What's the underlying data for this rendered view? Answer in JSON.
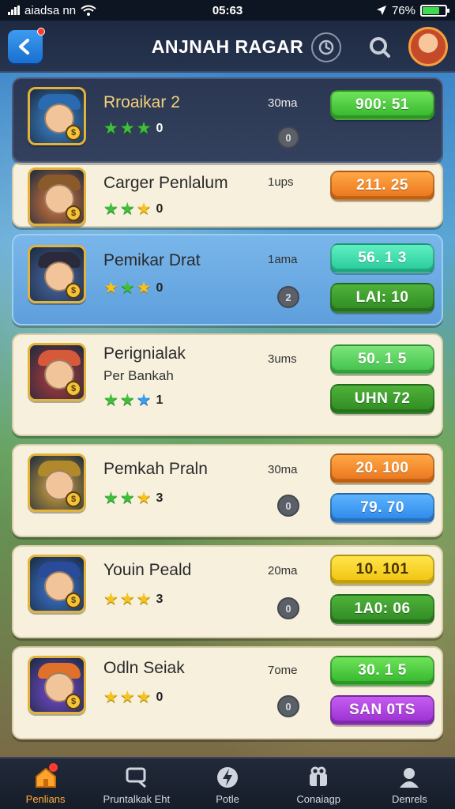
{
  "status_bar": {
    "carrier": "aiadsa nn",
    "time": "05:63",
    "battery": "76%",
    "icons": [
      "signal-icon",
      "wifi-icon",
      "location-arrow-icon",
      "battery-icon"
    ]
  },
  "header": {
    "title": "ANJNAH RAGAR",
    "icons": [
      "back-icon",
      "clock-icon",
      "search-icon",
      "profile-avatar"
    ]
  },
  "rows": [
    {
      "name": "Rroaikar 2",
      "sub": "",
      "stars": [
        "green",
        "green",
        "green"
      ],
      "star_count": "0",
      "time": "30ma",
      "chat": "0",
      "buttons": [
        {
          "label": "900: 51",
          "color": "green"
        }
      ],
      "style": "dark"
    },
    {
      "name": "Carger Penlalum",
      "sub": "",
      "stars": [
        "green",
        "green",
        "gold"
      ],
      "star_count": "0",
      "time": "1ups",
      "chat": "",
      "buttons": [
        {
          "label": "211. 25",
          "color": "orange"
        }
      ],
      "style": "light"
    },
    {
      "name": "Pemikar Drat",
      "sub": "",
      "stars": [
        "gold",
        "green",
        "gold"
      ],
      "star_count": "0",
      "time": "1ama",
      "chat": "2",
      "buttons": [
        {
          "label": "56. 1 3",
          "color": "teal"
        },
        {
          "label": "LAI: 10",
          "color": "dkgreen"
        }
      ],
      "style": "blue"
    },
    {
      "name": "Perignialak",
      "sub": "Per Bankah",
      "stars": [
        "green",
        "green",
        "blue"
      ],
      "star_count": "1",
      "time": "3ums",
      "chat": "",
      "buttons": [
        {
          "label": "50. 1 5",
          "color": "ltgreen"
        },
        {
          "label": "UHN 72",
          "color": "dkgreen"
        }
      ],
      "style": "light"
    },
    {
      "name": "Pemkah Praln",
      "sub": "",
      "stars": [
        "green",
        "green",
        "gold"
      ],
      "star_count": "3",
      "time": "30ma",
      "chat": "0",
      "buttons": [
        {
          "label": "20. 100",
          "color": "orange"
        },
        {
          "label": "79. 70",
          "color": "blue"
        }
      ],
      "style": "light"
    },
    {
      "name": "Youin Peald",
      "sub": "",
      "stars": [
        "gold",
        "gold",
        "gold"
      ],
      "star_count": "3",
      "time": "20ma",
      "chat": "0",
      "buttons": [
        {
          "label": "10. 101",
          "color": "yellow"
        },
        {
          "label": "1A0: 06",
          "color": "dkgreen"
        }
      ],
      "style": "light"
    },
    {
      "name": "Odln Seiak",
      "sub": "",
      "stars": [
        "gold",
        "gold",
        "gold"
      ],
      "star_count": "0",
      "time": "7ome",
      "chat": "0",
      "buttons": [
        {
          "label": "30. 1 5",
          "color": "green"
        },
        {
          "label": "SAN 0TS",
          "color": "purple"
        }
      ],
      "style": "light"
    }
  ],
  "nav": [
    {
      "label": "Penlians",
      "icon": "home-icon",
      "active": true
    },
    {
      "label": "Pruntalkak Eht",
      "icon": "chat-icon",
      "active": false
    },
    {
      "label": "Potle",
      "icon": "lightning-icon",
      "active": false
    },
    {
      "label": "Conaiagp",
      "icon": "gift-icon",
      "active": false
    },
    {
      "label": "Denrels",
      "icon": "user-icon",
      "active": false
    }
  ]
}
